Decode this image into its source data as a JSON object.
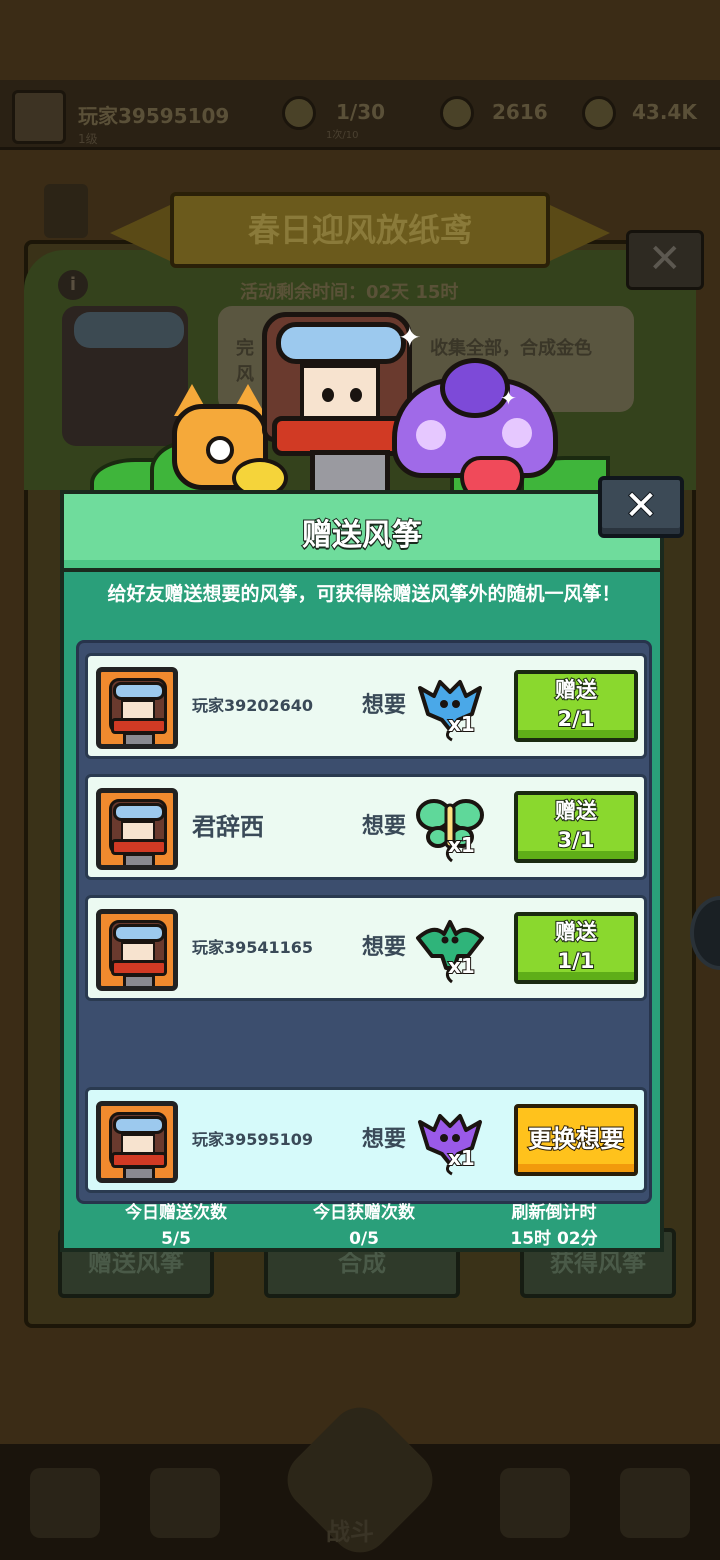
{
  "background": {
    "player_name": "玩家39595109",
    "player_level": "1级",
    "stat_1": "1/30",
    "stat_1_sub": "1次/10",
    "stat_2": "2616",
    "stat_3": "43.4K",
    "event_title": "春日迎风放纸鸢",
    "event_timer": "活动剩余时间：02天 15时",
    "bubble_line_1": "完",
    "bubble_line_2": "收集全部，合成金色",
    "bubble_line_3": "风",
    "bottom_buttons": [
      "赠送风筝",
      "合成",
      "获得风筝"
    ],
    "nav_center_label": "战斗"
  },
  "dialog": {
    "title": "赠送风筝",
    "close_label": "✕",
    "description": "给好友赠送想要的风筝，可获得除赠送风筝外的随机一风筝！",
    "want_label": "想要",
    "friends": [
      {
        "name": "玩家39202640",
        "kite_color": "#4aa8e8",
        "kite_icon": "blue-bat-kite-icon",
        "qty": "x1",
        "btn_line1": "赠送",
        "btn_line2": "2/1"
      },
      {
        "name": "君辞西",
        "kite_color": "#5fd89a",
        "kite_icon": "green-butterfly-kite-icon",
        "qty": "x1",
        "btn_line1": "赠送",
        "btn_line2": "3/1"
      },
      {
        "name": "玩家39541165",
        "kite_color": "#2fb47a",
        "kite_icon": "green-bird-kite-icon",
        "qty": "x1",
        "btn_line1": "赠送",
        "btn_line2": "1/1"
      }
    ],
    "self": {
      "name": "玩家39595109",
      "kite_color": "#9a5ae8",
      "kite_icon": "purple-bat-kite-icon",
      "qty": "x1",
      "change_label": "更换想要"
    },
    "stats": [
      {
        "label": "今日赠送次数",
        "value": "5/5"
      },
      {
        "label": "今日获赠次数",
        "value": "0/5"
      },
      {
        "label": "刷新倒计时",
        "value": "15时 02分"
      }
    ]
  },
  "colors": {
    "dialog_header": "#6fdc9c",
    "dialog_body": "#2a9f7a",
    "list_area": "#3c4e6e",
    "give_button": "#8ad82e",
    "change_button": "#ffc21c"
  }
}
